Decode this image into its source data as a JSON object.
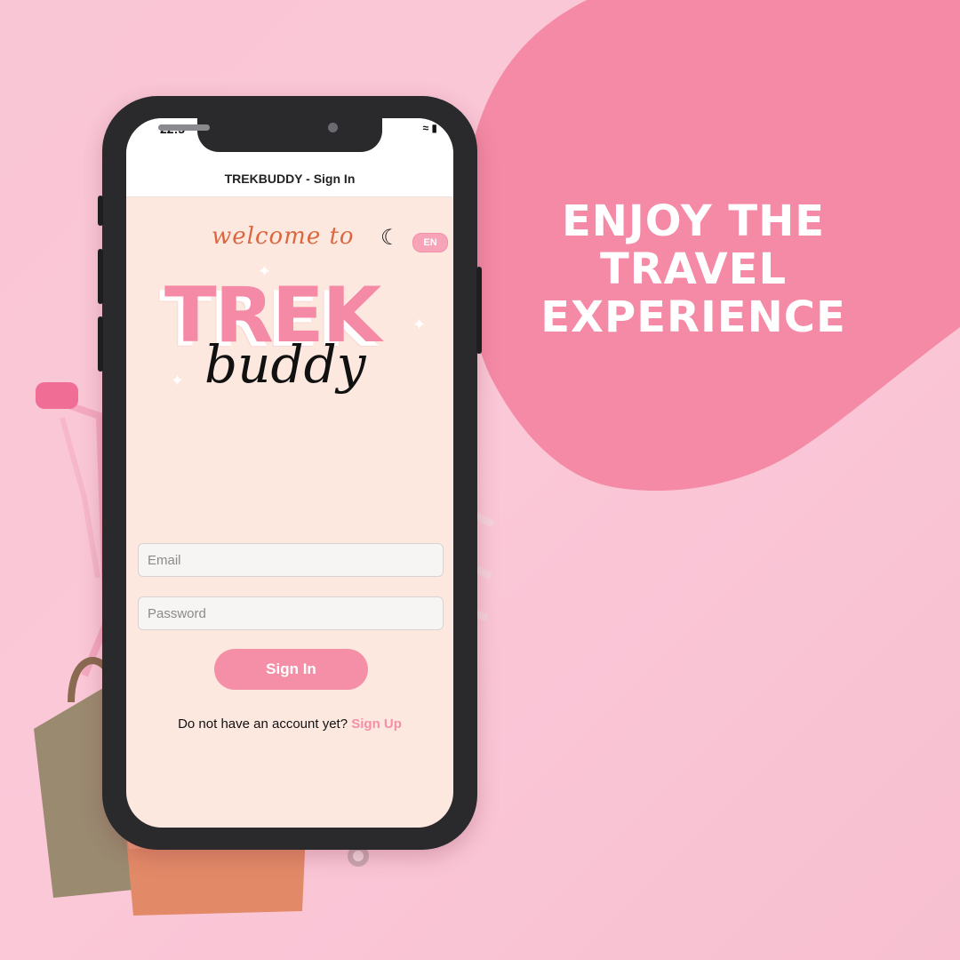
{
  "colors": {
    "background": "#fbc8d8",
    "blob": "#f48aa6",
    "screen_bg": "#fde8df",
    "accent_pink": "#f58fa8",
    "welcome_orange": "#d9673f"
  },
  "headline": {
    "line1": "ENJOY THE",
    "line2": "TRAVEL",
    "line3": "EXPERIENCE"
  },
  "phone": {
    "status_time": "22:5",
    "status_icons": [
      "wifi-icon",
      "battery-icon"
    ],
    "nav_title": "TREKBUDDY - Sign In",
    "welcome_text": "welcome to",
    "theme_toggle_icon": "moon-icon",
    "language": "EN",
    "logo": {
      "word1": "TREK",
      "word2": "buddy"
    },
    "form": {
      "email_placeholder": "Email",
      "password_placeholder": "Password",
      "email_value": "",
      "password_value": ""
    },
    "signin_label": "Sign In",
    "signup_prompt": "Do not have an account yet?",
    "signup_link": "Sign Up"
  }
}
